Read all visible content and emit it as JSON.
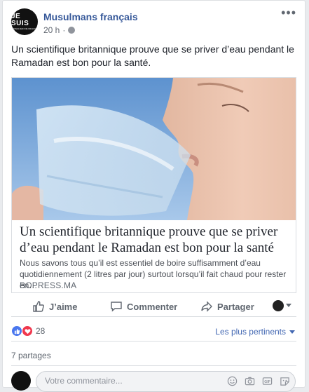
{
  "post": {
    "page_name": "Musulmans français",
    "time": "20 h",
    "dot": "·",
    "text": "Un scientifique britannique prouve que se priver d’eau pendant le Ramadan est bon pour la santé.",
    "avatar_text_big": "JE SUIS",
    "avatar_text_small": "MUSULMAN DE FRANCE"
  },
  "link": {
    "title": "Un scientifique britannique prouve que se priver d’eau pendant le Ramadan est bon pour la santé",
    "description": "Nous savons tous qu’il est essentiel de boire suffisamment d’eau quotidiennement (2 litres par jour) surtout lorsqu’il fait chaud pour rester en…",
    "domain": "BOPRESS.MA"
  },
  "actions": {
    "like": "J’aime",
    "comment": "Commenter",
    "share": "Partager"
  },
  "reactions": {
    "count": "28",
    "types": [
      "like",
      "love"
    ],
    "sort_label": "Les plus pertinents"
  },
  "shares": {
    "label": "7 partages"
  },
  "comment": {
    "placeholder": "Votre commentaire..."
  },
  "colors": {
    "link_blue": "#365899",
    "accent": "#4267b2",
    "love": "#f0374d",
    "like": "#4a77ee"
  }
}
